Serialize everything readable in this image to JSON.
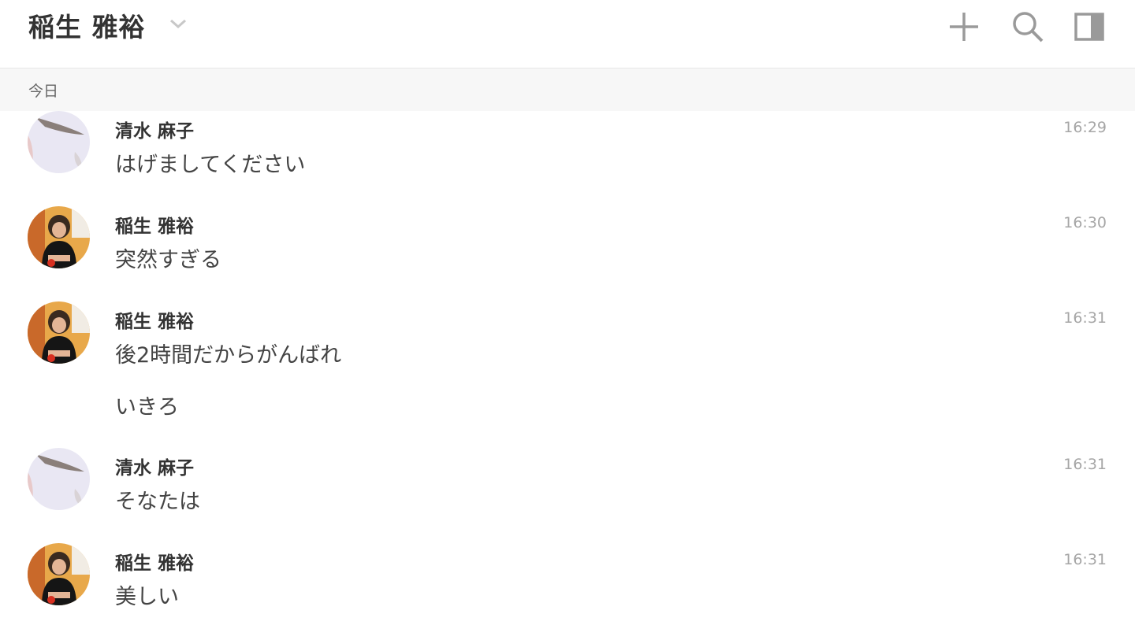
{
  "header": {
    "title": "稲生 雅裕",
    "icons": [
      "chevron-down-icon",
      "plus-icon",
      "search-icon",
      "panel-toggle-icon"
    ]
  },
  "date_divider": "今日",
  "messages": [
    {
      "sender": "清水 麻子",
      "avatar": "shimizu",
      "time": "16:29",
      "text": "はげましてください"
    },
    {
      "sender": "稲生 雅裕",
      "avatar": "inou",
      "time": "16:30",
      "text": "突然すぎる"
    },
    {
      "sender": "稲生 雅裕",
      "avatar": "inou",
      "time": "16:31",
      "text": "後2時間だからがんばれ",
      "text2": "いきろ"
    },
    {
      "sender": "清水 麻子",
      "avatar": "shimizu",
      "time": "16:31",
      "text": "そなたは"
    },
    {
      "sender": "稲生 雅裕",
      "avatar": "inou",
      "time": "16:31",
      "text": "美しい"
    }
  ],
  "colors": {
    "icon": "#9a9a9a",
    "time": "#a6a6a6",
    "date_bar": "#f7f7f7"
  }
}
